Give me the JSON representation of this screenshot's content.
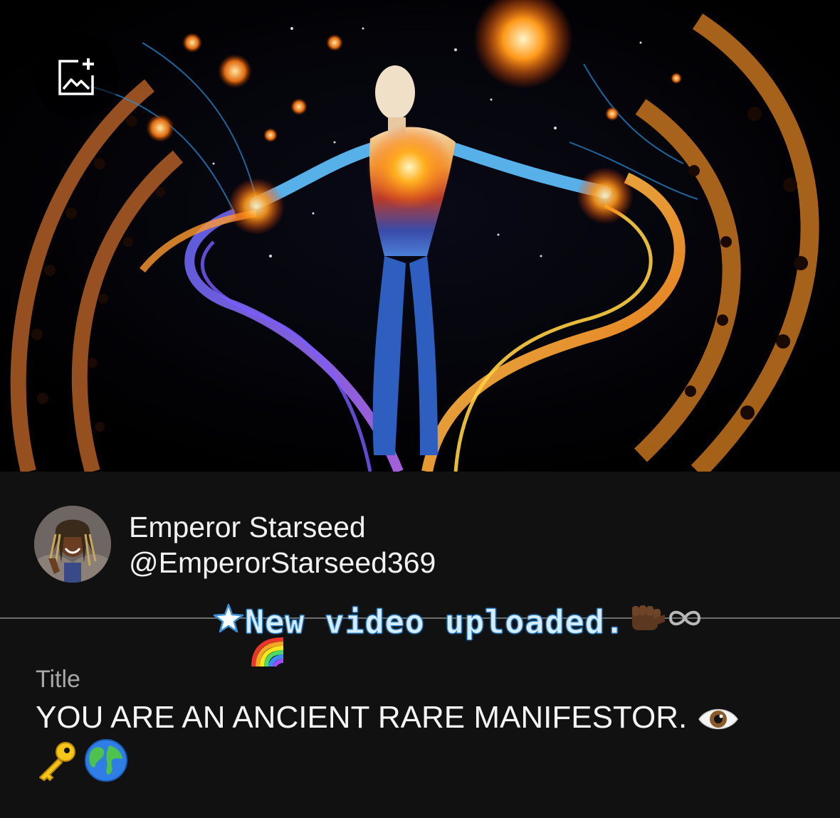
{
  "cover": {
    "image_description_icon": "cosmic-figure-illustration",
    "add_image_icon": "add-image-icon"
  },
  "channel": {
    "name": "Emperor Starseed",
    "handle": "@EmperorStarseed369"
  },
  "post": {
    "announcement": "New video uploaded.",
    "announcement_leading_icon": "star-icon",
    "announcement_trailing_icons": [
      "raised-fist-icon",
      "infinity-icon",
      "rainbow-icon"
    ]
  },
  "field": {
    "label": "Title",
    "value": "YOU ARE AN ANCIENT RARE MANIFESTOR.",
    "value_emojis": [
      "eye-icon",
      "key-icon",
      "globe-icon"
    ]
  },
  "colors": {
    "background": "#111111",
    "text": "#f2f2f2",
    "label": "#a8a8a8",
    "announcement": "#d6ecff",
    "divider": "#6e6e6e"
  }
}
